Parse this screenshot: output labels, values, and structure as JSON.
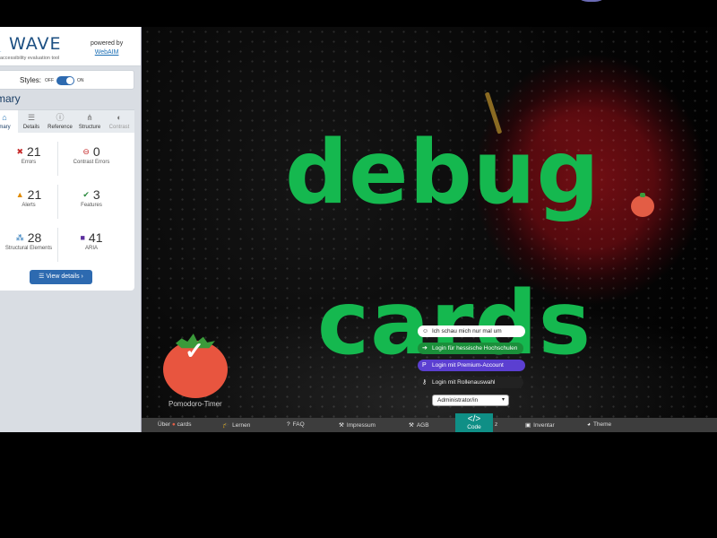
{
  "wave": {
    "logo_text": "WAVE",
    "logo_subtitle": "accessibility evaluation tool",
    "powered_by": "powered by",
    "powered_link": "WebAIM",
    "styles_label": "Styles:",
    "styles_off": "OFF",
    "styles_on": "ON",
    "summary_title": "mmary",
    "tabs": [
      {
        "label": "mary",
        "icon": "home-icon"
      },
      {
        "label": "Details",
        "icon": "list-icon"
      },
      {
        "label": "Reference",
        "icon": "info-icon"
      },
      {
        "label": "Structure",
        "icon": "structure-icon"
      },
      {
        "label": "Contrast",
        "icon": "contrast-icon"
      }
    ],
    "stats": [
      {
        "value": "21",
        "caption": "Errors",
        "icon": "error-icon",
        "color": "#c62b2b"
      },
      {
        "value": "0",
        "caption": "Contrast Errors",
        "icon": "contrast-error-icon",
        "color": "#c62b2b"
      },
      {
        "value": "21",
        "caption": "Alerts",
        "icon": "alert-icon",
        "color": "#e08a00"
      },
      {
        "value": "3",
        "caption": "Features",
        "icon": "feature-icon",
        "color": "#2b8a3e"
      },
      {
        "value": "28",
        "caption": "Structural Elements",
        "icon": "structure-icon",
        "color": "#1c6fb5"
      },
      {
        "value": "41",
        "caption": "ARIA",
        "icon": "aria-icon",
        "color": "#5b2f9e"
      }
    ],
    "view_details": "View details ›"
  },
  "site": {
    "headline_1": "debug",
    "headline_2": "cards",
    "pomodoro_label": "Pomodoro-Timer",
    "login_menu": [
      {
        "label": "Ich schau mich nur mal um",
        "icon": "smile-icon"
      },
      {
        "label": "Login für hessische Hochschulen",
        "icon": "login-icon"
      },
      {
        "label": "Login mit Premium-Account",
        "icon": "paypal-icon"
      },
      {
        "label": "Login mit Rollenauswahl",
        "icon": "key-icon"
      }
    ],
    "role_select": "Administrator/in",
    "footer": [
      {
        "label": "Über",
        "extra": "cards",
        "icon": "tomato-icon"
      },
      {
        "label": "Lernen",
        "icon": "graduation-cap-icon"
      },
      {
        "label": "FAQ",
        "icon": "question-icon"
      },
      {
        "label": "Impressum",
        "icon": "gavel-icon"
      },
      {
        "label": "AGB",
        "icon": "gavel-icon"
      },
      {
        "label": "z",
        "icon": ""
      },
      {
        "label": "Inventar",
        "icon": "box-icon"
      },
      {
        "label": "Theme",
        "icon": "palette-icon"
      }
    ],
    "code_label": "Code",
    "code_symbol": "</>"
  },
  "colors": {
    "accent_green": "#15b84f",
    "wave_blue": "#2d6ab0",
    "footer_bg": "#3d3d3d",
    "code_teal": "#0f8f86"
  }
}
